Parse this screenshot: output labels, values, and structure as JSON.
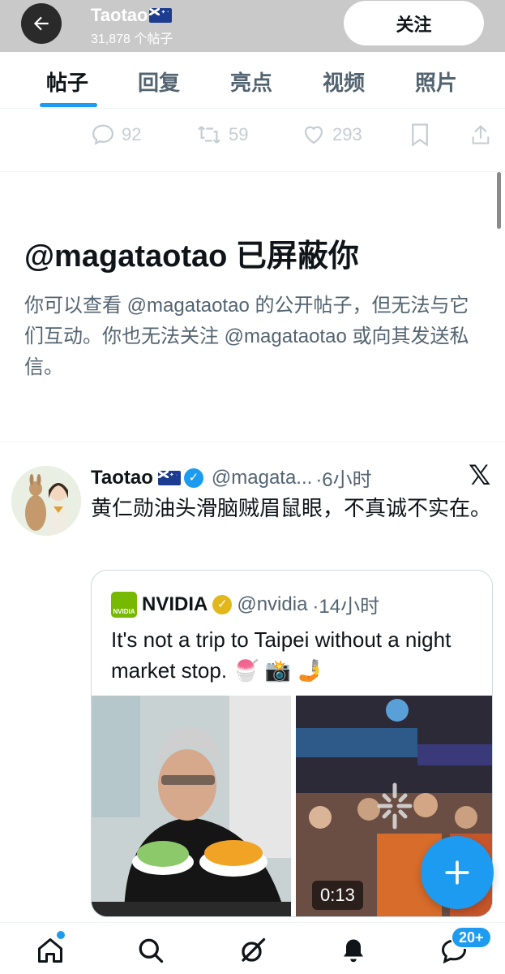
{
  "header": {
    "name": "Taotao",
    "post_count": "31,878 个帖子",
    "follow_label": "关注"
  },
  "tabs": [
    {
      "label": "帖子",
      "active": true
    },
    {
      "label": "回复",
      "active": false
    },
    {
      "label": "亮点",
      "active": false
    },
    {
      "label": "视频",
      "active": false
    },
    {
      "label": "照片",
      "active": false
    }
  ],
  "actions": {
    "replies": "92",
    "reposts": "59",
    "likes": "293"
  },
  "blocked": {
    "title": "@magataotao 已屏蔽你",
    "body": "你可以查看 @magataotao 的公开帖子，但无法与它们互动。你也无法关注 @magataotao 或向其发送私信。"
  },
  "tweet": {
    "name": "Taotao",
    "handle": "@magata...",
    "time": "·6小时",
    "text": "黄仁勋油头滑脑贼眉鼠眼，不真诚不实在。"
  },
  "quote": {
    "name": "NVIDIA",
    "handle": "@nvidia",
    "time": "·14小时",
    "logo_text": "NVIDIA",
    "text": "It's not a trip to Taipei without a night market stop. 🍧 📸 🤳",
    "video_duration": "0:13"
  },
  "nav": {
    "messages_badge": "20+"
  },
  "colors": {
    "accent": "#1d9bf0",
    "verified_gold": "#e2b719",
    "nvidia_green": "#76b900"
  },
  "icons": [
    "back-arrow-icon",
    "reply-icon",
    "repost-icon",
    "like-icon",
    "bookmark-icon",
    "share-icon",
    "verified-icon",
    "x-logo-icon",
    "compose-plus-icon",
    "home-icon",
    "search-icon",
    "grok-icon",
    "notifications-icon",
    "messages-icon"
  ]
}
